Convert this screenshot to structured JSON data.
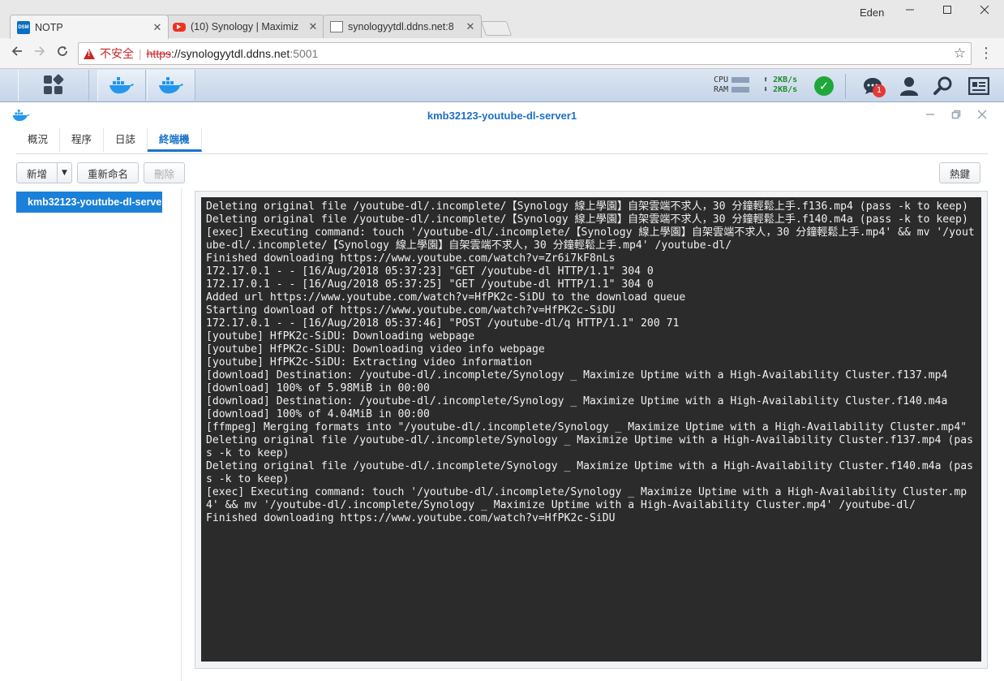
{
  "browser": {
    "tabs": [
      {
        "title": "NOTP",
        "favicon": "dsm-icon",
        "active": true
      },
      {
        "title": "(10) Synology | Maximiz",
        "favicon": "youtube-icon",
        "active": false
      },
      {
        "title": "synologyytdl.ddns.net:8",
        "favicon": "document-icon",
        "active": false
      }
    ],
    "close_glyph": "✕",
    "user": "Eden",
    "security_label": "不安全",
    "separator": "|",
    "url_scheme": "https",
    "url_host": "://synologyytdl.ddns.net",
    "url_port": ":5001"
  },
  "taskbar": {
    "cpu_label": "CPU",
    "ram_label": "RAM",
    "upload": "2KB/s",
    "download": "2KB/s",
    "notification_count": "1"
  },
  "window": {
    "title": "kmb32123-youtube-dl-server1",
    "tabs": [
      "概況",
      "程序",
      "日誌",
      "終端機"
    ],
    "active_tab": 3
  },
  "toolbar": {
    "add_label": "新增",
    "rename_label": "重新命名",
    "delete_label": "刪除",
    "settings_label": "熱鍵"
  },
  "sidebar": {
    "items": [
      {
        "label": "kmb32123-youtube-dl-server1"
      }
    ]
  },
  "terminal": {
    "lines": [
      "Deleting original file /youtube-dl/.incomplete/【Synology 線上學園】自架雲端不求人，30 分鐘輕鬆上手.f136.mp4 (pass -k to keep)",
      "Deleting original file /youtube-dl/.incomplete/【Synology 線上學園】自架雲端不求人，30 分鐘輕鬆上手.f140.m4a (pass -k to keep)",
      "[exec] Executing command: touch '/youtube-dl/.incomplete/【Synology 線上學園】自架雲端不求人，30 分鐘輕鬆上手.mp4' && mv '/youtube-dl/.incomplete/【Synology 線上學園】自架雲端不求人，30 分鐘輕鬆上手.mp4' /youtube-dl/",
      "Finished downloading https://www.youtube.com/watch?v=Zr6i7kF8nLs",
      "172.17.0.1 - - [16/Aug/2018 05:37:23] \"GET /youtube-dl HTTP/1.1\" 304 0",
      "172.17.0.1 - - [16/Aug/2018 05:37:25] \"GET /youtube-dl HTTP/1.1\" 304 0",
      "Added url https://www.youtube.com/watch?v=HfPK2c-SiDU to the download queue",
      "Starting download of https://www.youtube.com/watch?v=HfPK2c-SiDU",
      "172.17.0.1 - - [16/Aug/2018 05:37:46] \"POST /youtube-dl/q HTTP/1.1\" 200 71",
      "[youtube] HfPK2c-SiDU: Downloading webpage",
      "[youtube] HfPK2c-SiDU: Downloading video info webpage",
      "[youtube] HfPK2c-SiDU: Extracting video information",
      "[download] Destination: /youtube-dl/.incomplete/Synology _ Maximize Uptime with a High-Availability Cluster.f137.mp4",
      "[download] 100% of 5.98MiB in 00:00",
      "[download] Destination: /youtube-dl/.incomplete/Synology _ Maximize Uptime with a High-Availability Cluster.f140.m4a",
      "[download] 100% of 4.04MiB in 00:00",
      "[ffmpeg] Merging formats into \"/youtube-dl/.incomplete/Synology _ Maximize Uptime with a High-Availability Cluster.mp4\"",
      "Deleting original file /youtube-dl/.incomplete/Synology _ Maximize Uptime with a High-Availability Cluster.f137.mp4 (pass -k to keep)",
      "Deleting original file /youtube-dl/.incomplete/Synology _ Maximize Uptime with a High-Availability Cluster.f140.m4a (pass -k to keep)",
      "[exec] Executing command: touch '/youtube-dl/.incomplete/Synology _ Maximize Uptime with a High-Availability Cluster.mp4' && mv '/youtube-dl/.incomplete/Synology _ Maximize Uptime with a High-Availability Cluster.mp4' /youtube-dl/",
      "Finished downloading https://www.youtube.com/watch?v=HfPK2c-SiDU"
    ]
  },
  "colors": {
    "accent": "#1a80d9",
    "terminal_bg": "#2b2b2b",
    "status_ok": "#1fa83a",
    "insecure": "#c62828"
  }
}
